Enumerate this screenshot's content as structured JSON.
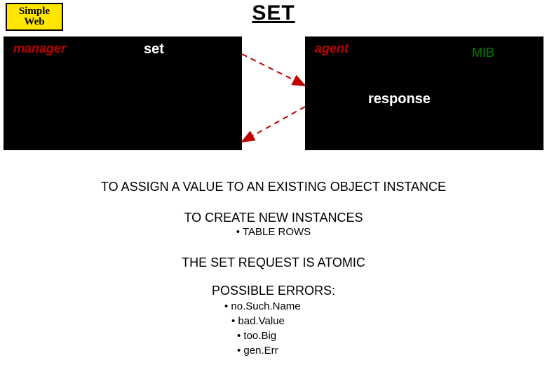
{
  "logo": {
    "line1": "Simple",
    "line2": "Web"
  },
  "title": "SET",
  "diagram": {
    "manager_label": "manager",
    "set_label": "set",
    "agent_label": "agent",
    "mib_label": "MIB",
    "response_label": "response"
  },
  "text": {
    "assign": "TO ASSIGN A VALUE TO AN EXISTING OBJECT INSTANCE",
    "create": "TO CREATE NEW INSTANCES",
    "table_rows": "• TABLE ROWS",
    "atomic": "THE SET REQUEST IS ATOMIC",
    "errors_heading": "POSSIBLE ERRORS:",
    "errors": [
      "no.Such.Name",
      "bad.Value",
      "too.Big",
      "gen.Err"
    ]
  }
}
